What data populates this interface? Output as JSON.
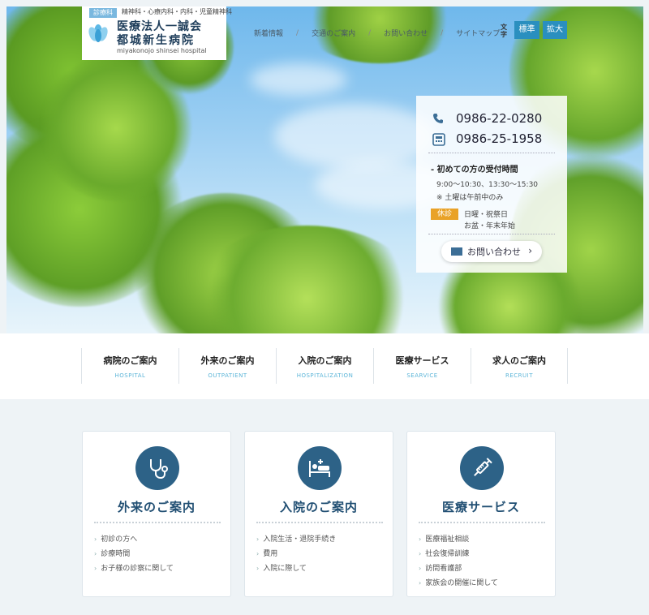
{
  "logo": {
    "tag": "診療科",
    "departments": "精神科・心療内科・内科・児童精神科",
    "name_line1": "医療法人一誠会",
    "name_line2": "都城新生病院",
    "romaji": "miyakonojo shinsei hospital"
  },
  "top_nav": {
    "items": [
      "新着情報",
      "交通のご案内",
      "お問い合わせ",
      "サイトマップ"
    ],
    "separator": "/"
  },
  "font_size": {
    "label": "文字",
    "standard": "標準",
    "large": "拡大"
  },
  "info": {
    "tel": "0986-22-0280",
    "fax": "0986-25-1958",
    "hours_title": "- 初めての方の受付時間",
    "hours_time": "9:00〜10:30、13:30〜15:30",
    "hours_note": "※ 土曜は午前中のみ",
    "closed_badge": "休診",
    "closed_line1": "日曜・祝祭日",
    "closed_line2": "お盆・年末年始",
    "contact_label": "お問い合わせ"
  },
  "sub_nav": [
    {
      "jp": "病院のご案内",
      "en": "HOSPITAL"
    },
    {
      "jp": "外来のご案内",
      "en": "OUTPATIENT"
    },
    {
      "jp": "入院のご案内",
      "en": "HOSPITALIZATION"
    },
    {
      "jp": "医療サービス",
      "en": "SEARVICE"
    },
    {
      "jp": "求人のご案内",
      "en": "RECRUIT"
    }
  ],
  "cards": [
    {
      "title": "外来のご案内",
      "icon": "stethoscope-icon",
      "items": [
        "初診の方へ",
        "診療時間",
        "お子様の診察に関して"
      ]
    },
    {
      "title": "入院のご案内",
      "icon": "hospital-bed-icon",
      "items": [
        "入院生活・退院手続き",
        "費用",
        "入院に際して"
      ]
    },
    {
      "title": "医療サービス",
      "icon": "syringe-icon",
      "items": [
        "医療福祉相談",
        "社会復帰訓練",
        "訪問看護部",
        "家族会の開催に関して"
      ]
    }
  ],
  "colors": {
    "accent": "#2a8fbf",
    "card_icon_bg": "#2d6287",
    "badge": "#e9a227",
    "page_bg": "#eef3f6"
  }
}
